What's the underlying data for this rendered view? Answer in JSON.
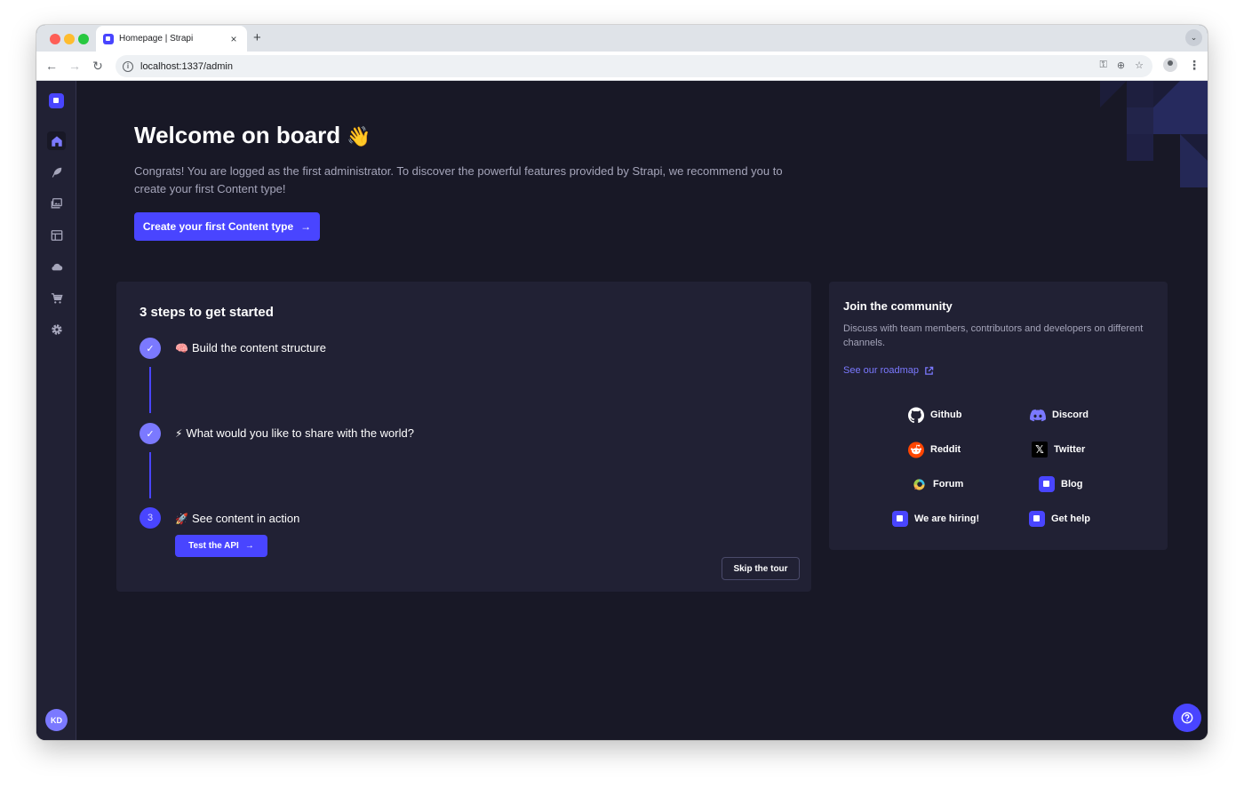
{
  "browser": {
    "tab_title": "Homepage | Strapi",
    "tab_close": "×",
    "new_tab": "+",
    "url": "localhost:1337/admin"
  },
  "welcome": {
    "title": "Welcome on board",
    "emoji": "👋",
    "description": "Congrats! You are logged as the first administrator. To discover the powerful features provided by Strapi, we recommend you to create your first Content type!",
    "cta_label": "Create your first Content type"
  },
  "steps": {
    "title": "3 steps to get started",
    "items": [
      {
        "emoji": "🧠",
        "label": "Build the content structure",
        "status": "done"
      },
      {
        "emoji": "⚡",
        "label": "What would you like to share with the world?",
        "status": "done"
      },
      {
        "number": "3",
        "emoji": "🚀",
        "label": "See content in action",
        "status": "current"
      }
    ],
    "test_api_label": "Test the API",
    "skip_label": "Skip the tour"
  },
  "community": {
    "title": "Join the community",
    "description": "Discuss with team members, contributors and developers on different channels.",
    "roadmap_label": "See our roadmap",
    "links": [
      {
        "label": "Github",
        "icon": "github-icon"
      },
      {
        "label": "Discord",
        "icon": "discord-icon"
      },
      {
        "label": "Reddit",
        "icon": "reddit-icon"
      },
      {
        "label": "Twitter",
        "icon": "x-twitter-icon"
      },
      {
        "label": "Forum",
        "icon": "forum-icon"
      },
      {
        "label": "Blog",
        "icon": "strapi-icon"
      },
      {
        "label": "We are hiring!",
        "icon": "strapi-icon"
      },
      {
        "label": "Get help",
        "icon": "strapi-icon"
      }
    ]
  },
  "user": {
    "initials": "KD"
  },
  "colors": {
    "primary": "#4945ff",
    "primary_light": "#7b79ff",
    "background": "#181826",
    "surface": "#212134",
    "text_muted": "#a5a5ba"
  }
}
